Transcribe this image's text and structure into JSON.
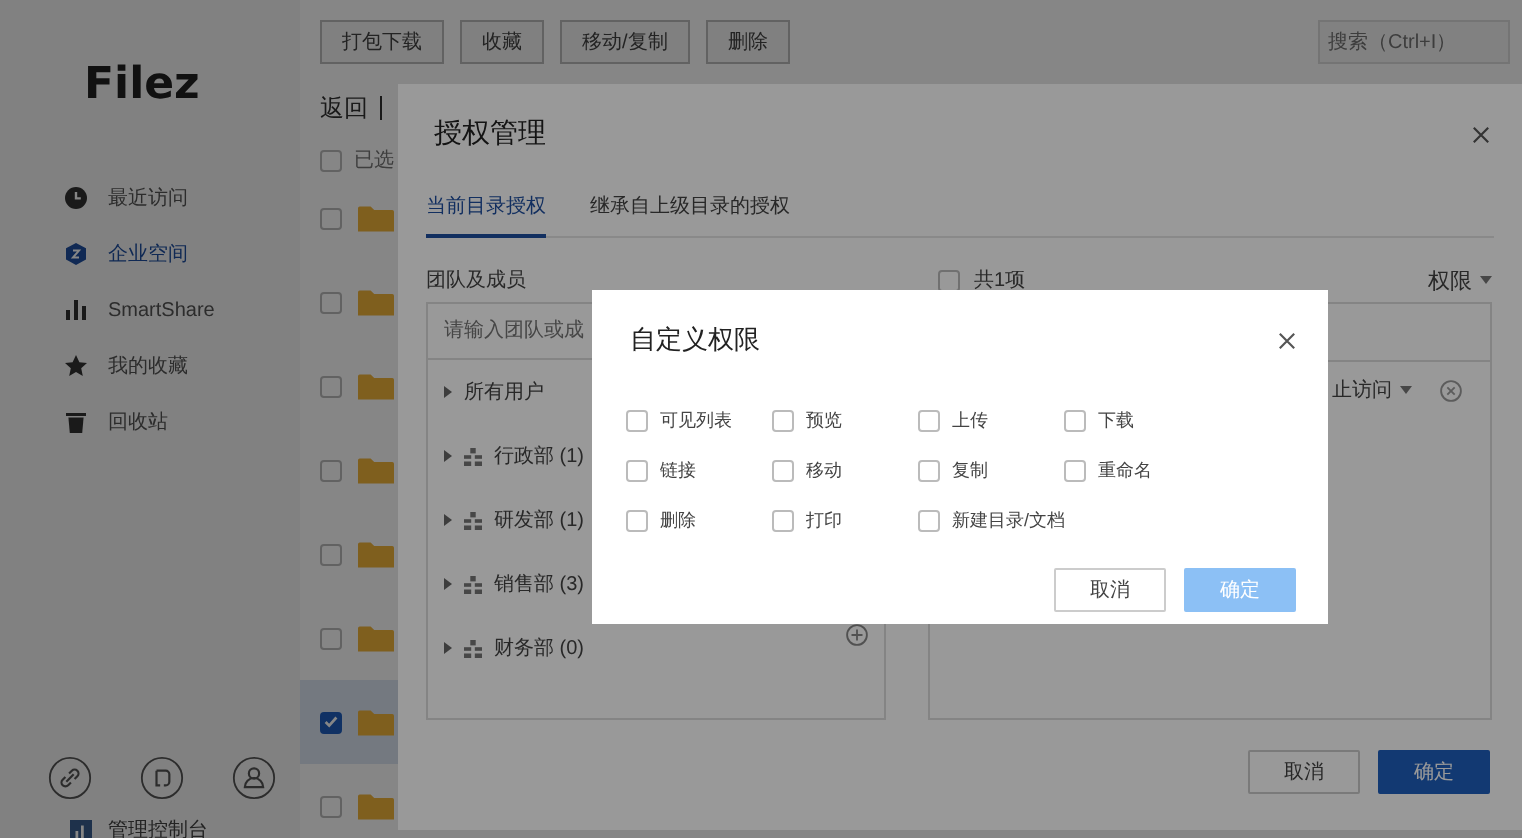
{
  "sidebar": {
    "logo": "Filez",
    "items": [
      {
        "label": "最近访问",
        "selected": false
      },
      {
        "label": "企业空间",
        "selected": true
      },
      {
        "label": "SmartShare",
        "selected": false
      },
      {
        "label": "我的收藏",
        "selected": false
      },
      {
        "label": "回收站",
        "selected": false
      }
    ],
    "footer_item": "管理控制台"
  },
  "toolbar": {
    "buttons": [
      "打包下载",
      "收藏",
      "移动/复制",
      "删除"
    ],
    "search": {
      "placeholder": "搜索（Ctrl+I）"
    }
  },
  "file_list": {
    "back": "返回",
    "header": "已选",
    "all_checked": false,
    "rows": [
      {
        "selected": false
      },
      {
        "selected": false
      },
      {
        "selected": false
      },
      {
        "selected": false
      },
      {
        "selected": false
      },
      {
        "selected": false
      },
      {
        "selected": true
      },
      {
        "selected": false
      }
    ]
  },
  "auth_dialog": {
    "title": "授权管理",
    "tabs": [
      {
        "label": "当前目录授权",
        "selected": true
      },
      {
        "label": "继承自上级目录的授权",
        "selected": false
      }
    ],
    "members_label": "团队及成员",
    "search": {
      "placeholder": "请输入团队或成"
    },
    "tree": [
      {
        "label": "所有用户",
        "kind": "all"
      },
      {
        "label": "行政部 (1)",
        "kind": "group"
      },
      {
        "label": "研发部 (1)",
        "kind": "group"
      },
      {
        "label": "销售部 (3)",
        "kind": "group"
      },
      {
        "label": "财务部 (0)",
        "kind": "group"
      }
    ],
    "count": "共1项",
    "all_checked": false,
    "permission_header": "权限",
    "entries": [
      {
        "permission": "止访问"
      }
    ],
    "buttons": [
      {
        "label": "取消",
        "primary": false
      },
      {
        "label": "确定",
        "primary": true
      }
    ]
  },
  "custom_dialog": {
    "title": "自定义权限",
    "permissions": [
      {
        "label": "可见列表",
        "checked": false
      },
      {
        "label": "预览",
        "checked": false
      },
      {
        "label": "上传",
        "checked": false
      },
      {
        "label": "下载",
        "checked": false
      },
      {
        "label": "链接",
        "checked": false
      },
      {
        "label": "移动",
        "checked": false
      },
      {
        "label": "复制",
        "checked": false
      },
      {
        "label": "重命名",
        "checked": false
      },
      {
        "label": "删除",
        "checked": false
      },
      {
        "label": "打印",
        "checked": false
      },
      {
        "label": "新建目录/文档",
        "checked": false
      }
    ],
    "buttons": [
      {
        "label": "取消",
        "primary": false
      },
      {
        "label": "确定",
        "primary": true,
        "disabled": true
      }
    ]
  }
}
